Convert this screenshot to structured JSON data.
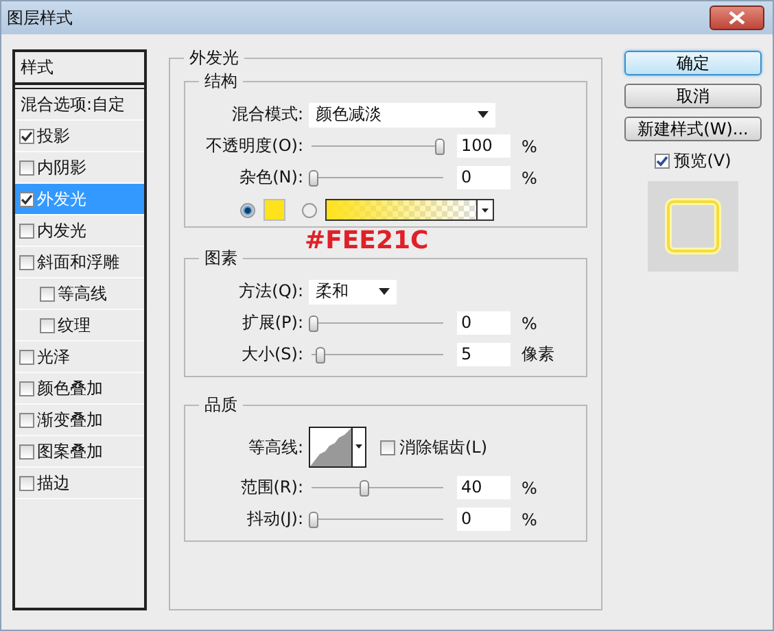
{
  "window": {
    "title": "图层样式"
  },
  "styles_panel": {
    "header": "样式",
    "items": [
      {
        "kind": "plain",
        "label": "混合选项:自定",
        "selected": false
      },
      {
        "kind": "check",
        "label": "投影",
        "checked": true,
        "selected": false
      },
      {
        "kind": "check",
        "label": "内阴影",
        "checked": false,
        "selected": false
      },
      {
        "kind": "check",
        "label": "外发光",
        "checked": true,
        "selected": true
      },
      {
        "kind": "check",
        "label": "内发光",
        "checked": false,
        "selected": false
      },
      {
        "kind": "check",
        "label": "斜面和浮雕",
        "checked": false,
        "selected": false,
        "children": [
          {
            "kind": "check",
            "label": "等高线",
            "checked": false,
            "selected": false
          },
          {
            "kind": "check",
            "label": "纹理",
            "checked": false,
            "selected": false
          }
        ]
      },
      {
        "kind": "check",
        "label": "光泽",
        "checked": false,
        "selected": false
      },
      {
        "kind": "check",
        "label": "颜色叠加",
        "checked": false,
        "selected": false
      },
      {
        "kind": "check",
        "label": "渐变叠加",
        "checked": false,
        "selected": false
      },
      {
        "kind": "check",
        "label": "图案叠加",
        "checked": false,
        "selected": false
      },
      {
        "kind": "check",
        "label": "描边",
        "checked": false,
        "selected": false
      }
    ]
  },
  "panel": {
    "title": "外发光",
    "sections": [
      {
        "title": "结构",
        "rows": [
          {
            "kind": "dropdown",
            "label": "混合模式:",
            "value": "颜色减淡"
          },
          {
            "kind": "slider",
            "label": "不透明度(O):",
            "level": 1,
            "value": "100",
            "unit": "%"
          },
          {
            "kind": "slider",
            "label": "杂色(N):",
            "level": 0,
            "value": "0",
            "unit": "%"
          },
          {
            "kind": "color",
            "solid_selected": true,
            "color": "#fee21c"
          }
        ]
      },
      {
        "title": "图素",
        "rows": [
          {
            "kind": "dropdown",
            "label": "方法(Q):",
            "value": "柔和"
          },
          {
            "kind": "slider",
            "label": "扩展(P):",
            "level": 0,
            "value": "0",
            "unit": "%"
          },
          {
            "kind": "slider",
            "label": "大小(S):",
            "level": 0.05,
            "value": "5",
            "unit": "像素"
          }
        ]
      },
      {
        "title": "品质",
        "rows": [
          {
            "kind": "contour",
            "label": "等高线:",
            "checkbox_label": "消除锯齿(L)",
            "checked": false
          },
          {
            "kind": "slider",
            "label": "范围(R):",
            "level": 0.4,
            "value": "40",
            "unit": "%"
          },
          {
            "kind": "slider",
            "label": "抖动(J):",
            "level": 0,
            "value": "0",
            "unit": "%"
          }
        ]
      }
    ]
  },
  "annotation": "#FEE21C",
  "buttons": [
    {
      "label": "确定",
      "default": true
    },
    {
      "label": "取消",
      "default": false
    },
    {
      "label": "新建样式(W)...",
      "default": false
    }
  ],
  "preview": {
    "label": "预览(V)",
    "checked": true
  }
}
